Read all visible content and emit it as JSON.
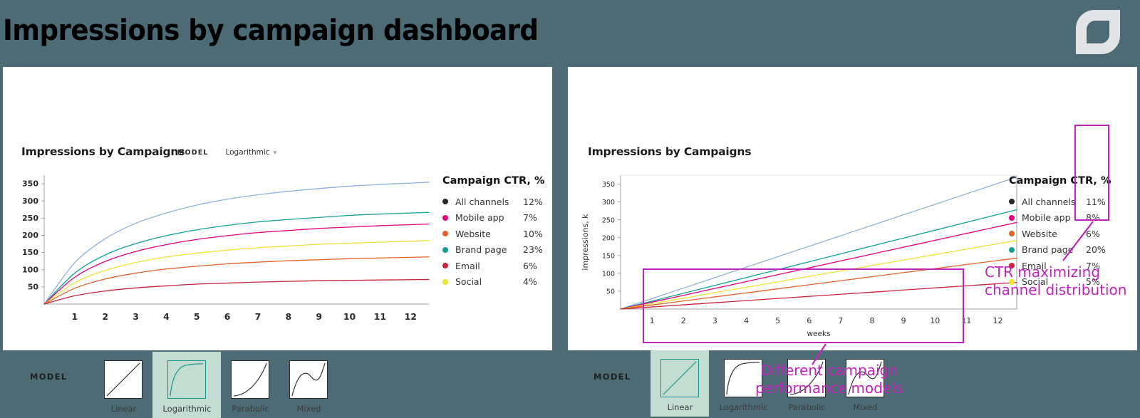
{
  "header": {
    "title": "Impressions by campaign dashboard",
    "logo_icon": "leaf-logo-icon",
    "background_color": "#4c6b74"
  },
  "colors": {
    "accent_magenta": "#c224bb",
    "selected_teal_bg": "#c3ddd3",
    "selected_teal_border": "#15948a",
    "panel_bg": "#ffffff"
  },
  "left_panel": {
    "title": "Impressions by Campaigns",
    "model_dropdown": {
      "label": "MODEL",
      "value": "Logarithmic",
      "caret_icon": "chevron-down-icon"
    },
    "legend": {
      "title": "Campaign CTR, %",
      "rows": [
        {
          "name": "All channels",
          "value": "12%",
          "color": "#23272a"
        },
        {
          "name": "Mobile app",
          "value": "7%",
          "color": "#e5007d"
        },
        {
          "name": "Website",
          "value": "10%",
          "color": "#e2622a"
        },
        {
          "name": "Brand page",
          "value": "23%",
          "color": "#11a093"
        },
        {
          "name": "Email",
          "value": "6%",
          "color": "#c8243b"
        },
        {
          "name": "Social",
          "value": "4%",
          "color": "#ede234"
        }
      ]
    },
    "model_strip": {
      "label": "MODEL",
      "options": [
        {
          "caption": "Linear",
          "shape": "linear",
          "selected": false
        },
        {
          "caption": "Logarithmic",
          "shape": "logarithmic",
          "selected": true
        },
        {
          "caption": "Parabolic",
          "shape": "parabolic",
          "selected": false
        },
        {
          "caption": "Mixed",
          "shape": "mixed",
          "selected": false
        }
      ]
    }
  },
  "right_panel": {
    "title": "Impressions by Campaigns",
    "legend": {
      "title": "Campaign CTR, %",
      "rows": [
        {
          "name": "All channels",
          "value": "11%",
          "color": "#23272a"
        },
        {
          "name": "Mobile app",
          "value": "8%",
          "color": "#e5007d"
        },
        {
          "name": "Website",
          "value": "6%",
          "color": "#e2622a"
        },
        {
          "name": "Brand page",
          "value": "20%",
          "color": "#11a093"
        },
        {
          "name": "Email",
          "value": "7%",
          "color": "#c8243b"
        },
        {
          "name": "Social",
          "value": "5%",
          "color": "#ede234"
        }
      ]
    },
    "model_strip": {
      "label": "MODEL",
      "options": [
        {
          "caption": "Linear",
          "shape": "linear",
          "selected": true
        },
        {
          "caption": "Logarithmic",
          "shape": "logarithmic",
          "selected": false
        },
        {
          "caption": "Parabolic",
          "shape": "parabolic",
          "selected": false
        },
        {
          "caption": "Mixed",
          "shape": "mixed",
          "selected": false
        }
      ]
    }
  },
  "annotations": [
    {
      "id": "ctr-annotation",
      "text_line1": "CTR maximizing",
      "text_line2": "channel distribution"
    },
    {
      "id": "model-annotation",
      "text_line1": "Different campaign",
      "text_line2": "performance models"
    }
  ],
  "chart_data": [
    {
      "id": "left-chart",
      "type": "line",
      "title": "Impressions by Campaigns",
      "xlabel": "",
      "ylabel": "",
      "model": "Logarithmic",
      "grid": false,
      "legend_position": "right",
      "x": [
        0,
        1,
        2,
        3,
        4,
        5,
        6,
        7,
        8,
        9,
        10,
        11,
        12
      ],
      "xticklabels": [
        "1",
        "2",
        "3",
        "4",
        "5",
        "6",
        "7",
        "8",
        "9",
        "10",
        "11",
        "12"
      ],
      "ylim": [
        0,
        375
      ],
      "yticks": [
        50,
        100,
        150,
        200,
        250,
        300,
        350
      ],
      "series": [
        {
          "name": "All channels",
          "color": "#8fb0dc",
          "ctr": "12%",
          "values": [
            0,
            120,
            190,
            235,
            265,
            288,
            305,
            318,
            328,
            336,
            343,
            348,
            352
          ]
        },
        {
          "name": "Brand page",
          "color": "#11a093",
          "ctr": "23%",
          "values": [
            0,
            90,
            143,
            176,
            199,
            216,
            229,
            239,
            246,
            252,
            258,
            262,
            265
          ]
        },
        {
          "name": "Mobile app",
          "color": "#e5007d",
          "ctr": "7%",
          "values": [
            0,
            78,
            124,
            153,
            173,
            188,
            199,
            208,
            214,
            220,
            224,
            228,
            231
          ]
        },
        {
          "name": "Social",
          "color": "#ede234",
          "ctr": "4%",
          "values": [
            0,
            62,
            98,
            121,
            137,
            148,
            157,
            164,
            169,
            174,
            177,
            180,
            183
          ]
        },
        {
          "name": "Website",
          "color": "#e2622a",
          "ctr": "10%",
          "values": [
            0,
            46,
            73,
            90,
            102,
            110,
            117,
            122,
            126,
            129,
            132,
            134,
            136
          ]
        },
        {
          "name": "Email",
          "color": "#c8243b",
          "ctr": "6%",
          "values": [
            0,
            24,
            38,
            47,
            53,
            58,
            61,
            64,
            66,
            68,
            69,
            70,
            71
          ]
        }
      ]
    },
    {
      "id": "right-chart",
      "type": "line",
      "title": "Impressions by Campaigns",
      "xlabel": "weeks",
      "ylabel": "impressions, k",
      "model": "Linear",
      "grid": false,
      "legend_position": "right",
      "x": [
        0,
        1,
        2,
        3,
        4,
        5,
        6,
        7,
        8,
        9,
        10,
        11,
        12
      ],
      "xticklabels": [
        "1",
        "2",
        "3",
        "4",
        "5",
        "6",
        "7",
        "8",
        "9",
        "10",
        "11",
        "12"
      ],
      "ylim": [
        0,
        375
      ],
      "yticks": [
        50,
        100,
        150,
        200,
        250,
        300,
        350
      ],
      "series": [
        {
          "name": "All channels",
          "color": "#8fb0dc",
          "ctr": "11%",
          "values": [
            0,
            29.3,
            58.7,
            88,
            117.3,
            146.7,
            176,
            205.3,
            234.7,
            264,
            293.3,
            322.7,
            352
          ]
        },
        {
          "name": "Brand page",
          "color": "#11a093",
          "ctr": "20%",
          "values": [
            0,
            22.1,
            44.2,
            66.3,
            88.3,
            110.4,
            132.5,
            154.6,
            176.7,
            198.8,
            220.8,
            242.9,
            265
          ]
        },
        {
          "name": "Mobile app",
          "color": "#e5007d",
          "ctr": "8%",
          "values": [
            0,
            19.3,
            38.5,
            57.8,
            77,
            96.3,
            115.5,
            134.8,
            154,
            173.3,
            192.5,
            211.8,
            231
          ]
        },
        {
          "name": "Social",
          "color": "#ede234",
          "ctr": "5%",
          "values": [
            0,
            15.3,
            30.5,
            45.8,
            61,
            76.3,
            91.5,
            106.8,
            122,
            137.3,
            152.5,
            167.8,
            183
          ]
        },
        {
          "name": "Website",
          "color": "#e2622a",
          "ctr": "6%",
          "values": [
            0,
            11.3,
            22.7,
            34,
            45.3,
            56.7,
            68,
            79.3,
            90.7,
            102,
            113.3,
            124.7,
            136
          ]
        },
        {
          "name": "Email",
          "color": "#c8243b",
          "ctr": "7%",
          "values": [
            0,
            5.9,
            11.8,
            17.8,
            23.7,
            29.6,
            35.5,
            41.4,
            47.3,
            53.3,
            59.2,
            65.1,
            71
          ]
        }
      ]
    }
  ]
}
